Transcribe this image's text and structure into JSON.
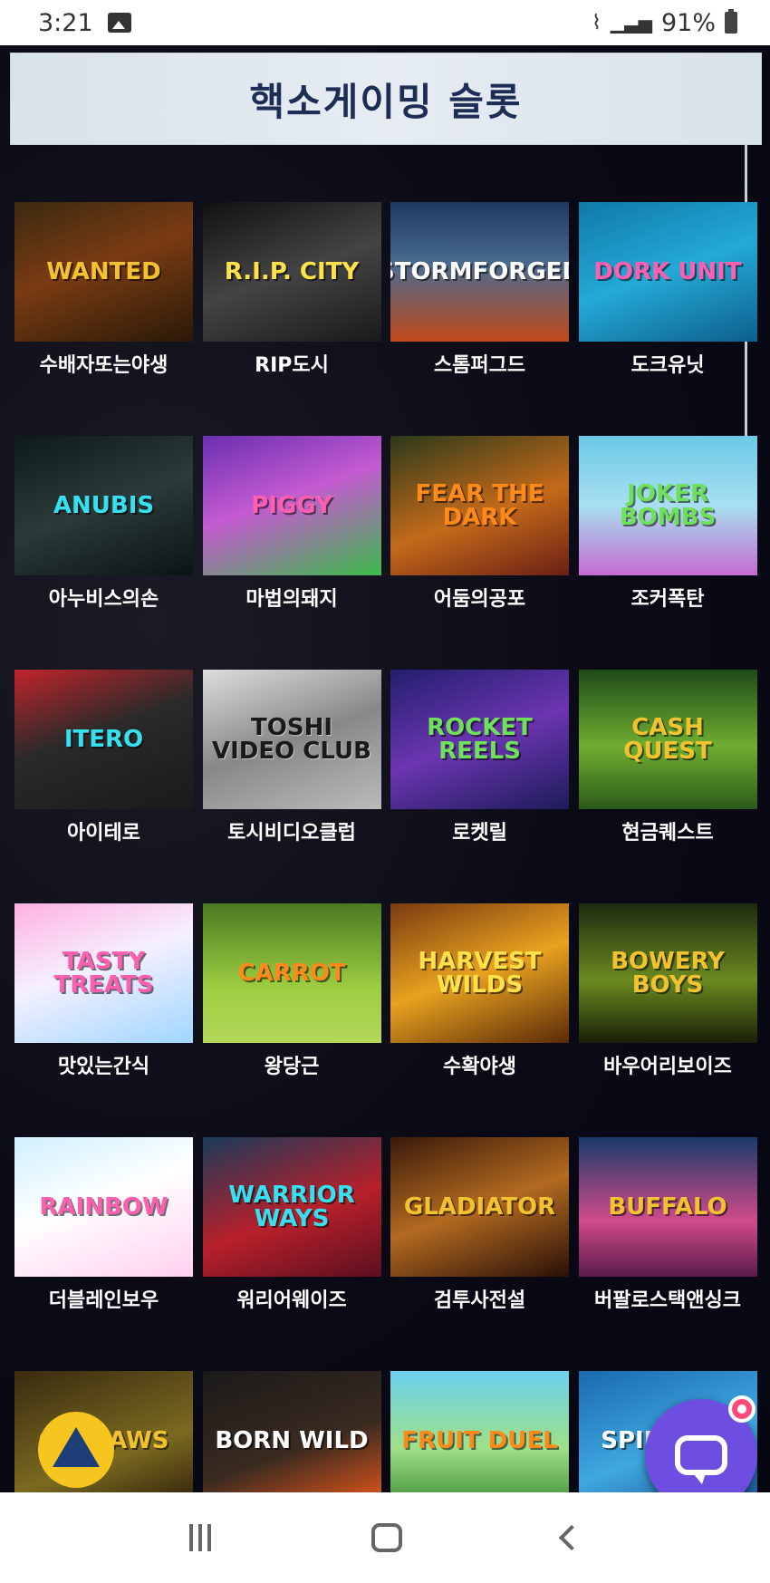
{
  "status_bar": {
    "time": "3:21",
    "battery": "91%"
  },
  "page": {
    "title": "핵소게이밍 슬롯"
  },
  "games": [
    {
      "thumb": "WANTED",
      "label": "수배자또는야생",
      "bg": "bg-1",
      "color": "c-gold"
    },
    {
      "thumb": "R.I.P. CITY",
      "label": "RIP도시",
      "bg": "bg-2",
      "color": "c-yellow"
    },
    {
      "thumb": "STORMFORGED",
      "label": "스톰퍼그드",
      "bg": "bg-3",
      "color": "c-white"
    },
    {
      "thumb": "DORK UNIT",
      "label": "도크유닛",
      "bg": "bg-4",
      "color": "c-pink"
    },
    {
      "thumb": "ANUBIS",
      "label": "아누비스의손",
      "bg": "bg-5",
      "color": "c-cyan"
    },
    {
      "thumb": "PIGGY",
      "label": "마법의돼지",
      "bg": "bg-6",
      "color": "c-pink"
    },
    {
      "thumb": "FEAR THE DARK",
      "label": "어둠의공포",
      "bg": "bg-7",
      "color": "c-orange"
    },
    {
      "thumb": "JOKER BOMBS",
      "label": "조커폭탄",
      "bg": "bg-8",
      "color": "c-green"
    },
    {
      "thumb": "ITERO",
      "label": "아이테로",
      "bg": "bg-9",
      "color": "c-cyan"
    },
    {
      "thumb": "TOSHI VIDEO CLUB",
      "label": "토시비디오클럽",
      "bg": "bg-10",
      "color": "c-black"
    },
    {
      "thumb": "ROCKET REELS",
      "label": "로켓릴",
      "bg": "bg-11",
      "color": "c-green"
    },
    {
      "thumb": "CASH QUEST",
      "label": "현금퀘스트",
      "bg": "bg-12",
      "color": "c-gold"
    },
    {
      "thumb": "TASTY TREATS",
      "label": "맛있는간식",
      "bg": "bg-13",
      "color": "c-pink"
    },
    {
      "thumb": "CARROT",
      "label": "왕당근",
      "bg": "bg-14",
      "color": "c-orange"
    },
    {
      "thumb": "HARVEST WILDS",
      "label": "수확야생",
      "bg": "bg-15",
      "color": "c-yellow"
    },
    {
      "thumb": "BOWERY BOYS",
      "label": "바우어리보이즈",
      "bg": "bg-16",
      "color": "c-gold"
    },
    {
      "thumb": "RAINBOW",
      "label": "더블레인보우",
      "bg": "bg-17",
      "color": "c-pink"
    },
    {
      "thumb": "WARRIOR WAYS",
      "label": "워리어웨이즈",
      "bg": "bg-18",
      "color": "c-cyan"
    },
    {
      "thumb": "GLADIATOR",
      "label": "검투사전설",
      "bg": "bg-19",
      "color": "c-gold"
    },
    {
      "thumb": "BUFFALO",
      "label": "버팔로스택앤싱크",
      "bg": "bg-20",
      "color": "c-gold"
    },
    {
      "thumb": "OUTLAWS",
      "label": "",
      "bg": "bg-21",
      "color": "c-gold"
    },
    {
      "thumb": "BORN WILD",
      "label": "",
      "bg": "bg-22",
      "color": "c-white"
    },
    {
      "thumb": "FRUIT DUEL",
      "label": "",
      "bg": "bg-23",
      "color": "c-orange"
    },
    {
      "thumb": "SPINNERS",
      "label": "",
      "bg": "bg-24",
      "color": "c-white"
    }
  ],
  "icons": {
    "accessibility": "accessibility-icon",
    "chat": "chat-icon"
  }
}
